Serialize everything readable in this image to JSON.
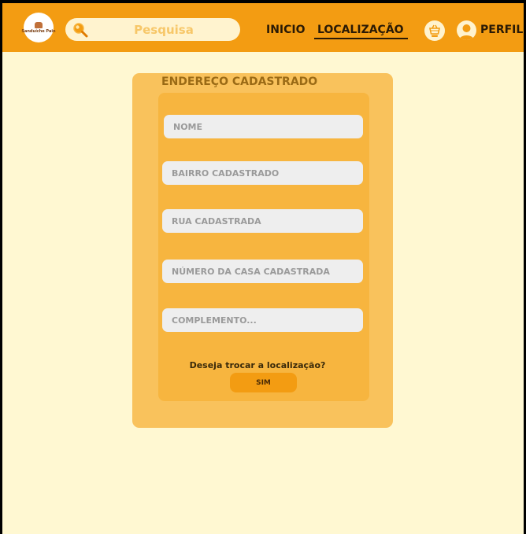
{
  "header": {
    "logo_text": "Sanduíche Pain",
    "search": {
      "placeholder": "Pesquisa"
    },
    "nav": {
      "inicio": "INICIO",
      "localizacao": "LOCALIZAÇÃO",
      "perfil": "PERFIL"
    },
    "icons": {
      "search": "search-icon",
      "cart": "cart-icon",
      "profile": "user-icon"
    }
  },
  "card": {
    "title": "ENDEREÇO CADASTRADO",
    "fields": [
      {
        "placeholder": "NOME"
      },
      {
        "placeholder": "BAIRRO CADASTRADO"
      },
      {
        "placeholder": "RUA CADASTRADA"
      },
      {
        "placeholder": "NÚMERO DA CASA CADASTRADA"
      },
      {
        "placeholder": "COMPLEMENTO..."
      }
    ],
    "question": "Deseja trocar a localização?",
    "confirm_label": "SIM"
  },
  "colors": {
    "header": "#F39C12",
    "page_background": "#FFF8D2",
    "card_outer": "#F9C25C",
    "card_inner": "#F7B53F",
    "field": "#EEEEEE"
  }
}
